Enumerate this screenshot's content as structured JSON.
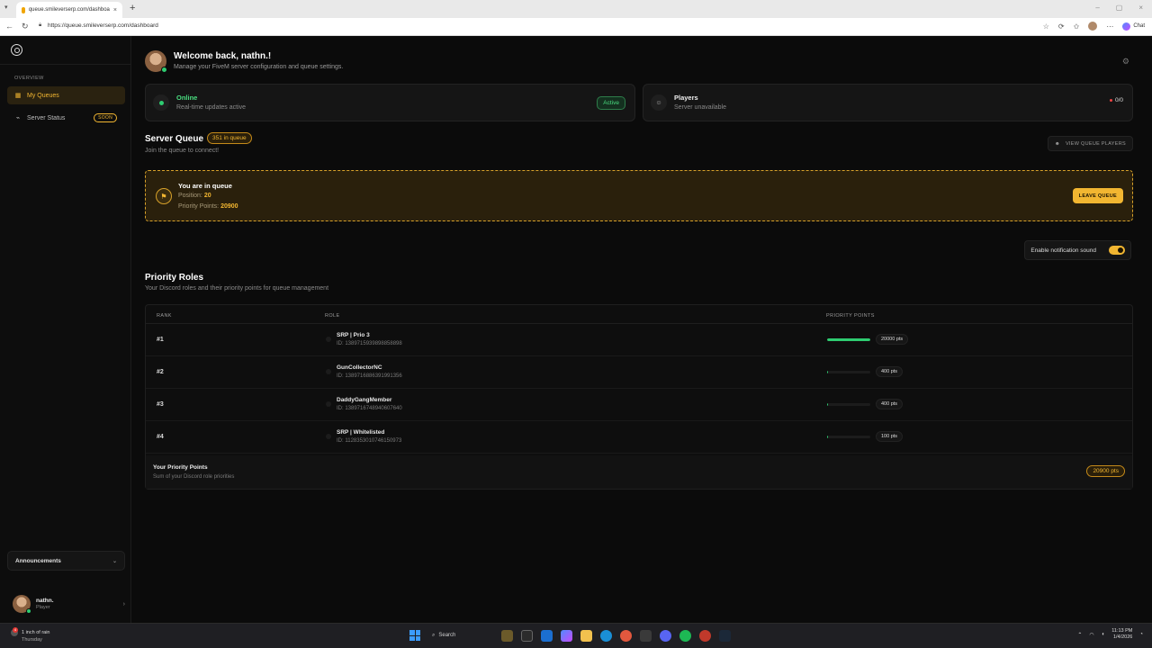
{
  "browser": {
    "tab_title": "queue.smileverserp.com/dashboa",
    "url": "https://queue.smileverserp.com/dashboard",
    "chat_label": "Chat"
  },
  "sidebar": {
    "section": "OVERVIEW",
    "items": [
      {
        "label": "My Queues",
        "icon": "queue-icon"
      },
      {
        "label": "Server Status",
        "icon": "activity-icon",
        "badge": "SOON"
      }
    ],
    "announcements": "Announcements",
    "user": {
      "name": "nathn.",
      "role": "Player"
    }
  },
  "header": {
    "title": "Welcome back, nathn.!",
    "subtitle": "Manage your FiveM server configuration and queue settings."
  },
  "status": {
    "online": {
      "title": "Online",
      "subtitle": "Real-time updates active",
      "badge": "Active"
    },
    "players": {
      "title": "Players",
      "subtitle": "Server unavailable",
      "count": "0/0"
    }
  },
  "server_queue": {
    "title": "Server Queue",
    "badge": "351 in queue",
    "subtitle": "Join the queue to connect!",
    "view_button": "VIEW QUEUE PLAYERS",
    "card": {
      "title": "You are in queue",
      "position_label": "Position:",
      "position_value": "20",
      "points_label": "Priority Points:",
      "points_value": "20900",
      "leave_button": "LEAVE QUEUE"
    },
    "notification_label": "Enable notification sound",
    "notification_on": true
  },
  "priority_roles": {
    "title": "Priority Roles",
    "subtitle": "Your Discord roles and their priority points for queue management",
    "columns": [
      "RANK",
      "ROLE",
      "PRIORITY POINTS"
    ],
    "rows": [
      {
        "rank": "#1",
        "role": "SRP | Prio 3",
        "id": "ID: 1389715939898858898",
        "points": "20000 pts",
        "fill": 1.0
      },
      {
        "rank": "#2",
        "role": "GunCollectorNC",
        "id": "ID: 1389716886391991356",
        "points": "400 pts",
        "fill": 0.02
      },
      {
        "rank": "#3",
        "role": "DaddyGangMember",
        "id": "ID: 1389716748940607640",
        "points": "400 pts",
        "fill": 0.02
      },
      {
        "rank": "#4",
        "role": "SRP | Whitelisted",
        "id": "ID: 1128353010746150973",
        "points": "100 pts",
        "fill": 0.005
      }
    ],
    "total": {
      "title": "Your Priority Points",
      "subtitle": "Sum of your Discord role priorities",
      "value": "20900 pts"
    }
  },
  "taskbar": {
    "weather": "1 inch of rain",
    "weather_sub": "Thursday",
    "weather_badge": "4",
    "search": "Search",
    "time": "11:13 PM",
    "date": "1/4/2026"
  }
}
